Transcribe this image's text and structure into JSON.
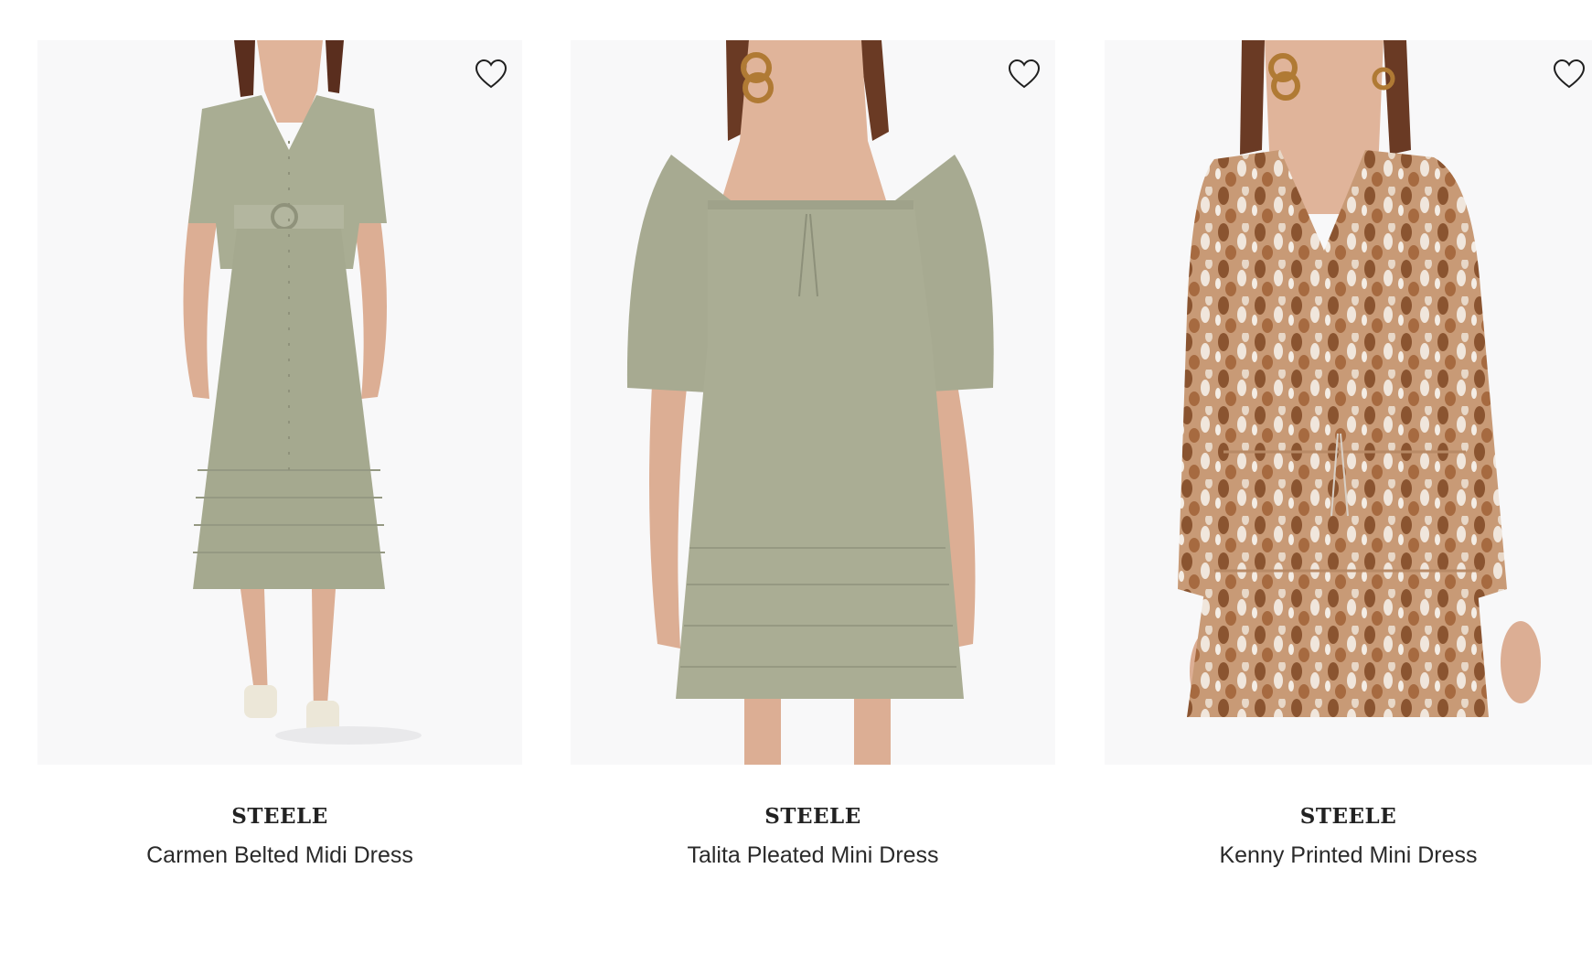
{
  "products": [
    {
      "brand": "STEELE",
      "name": "Carmen Belted Midi Dress",
      "image_icon": "dress-photo-icon",
      "dress_color": "#a9ad93"
    },
    {
      "brand": "STEELE",
      "name": "Talita Pleated Mini Dress",
      "image_icon": "dress-photo-icon",
      "dress_color": "#aaad94"
    },
    {
      "brand": "STEELE",
      "name": "Kenny Printed Mini Dress",
      "image_icon": "dress-photo-icon",
      "dress_color": "#a4714f"
    }
  ],
  "wishlist_icon": "heart-outline-icon",
  "colors": {
    "image_background": "#f8f8f9",
    "text": "#222222"
  }
}
